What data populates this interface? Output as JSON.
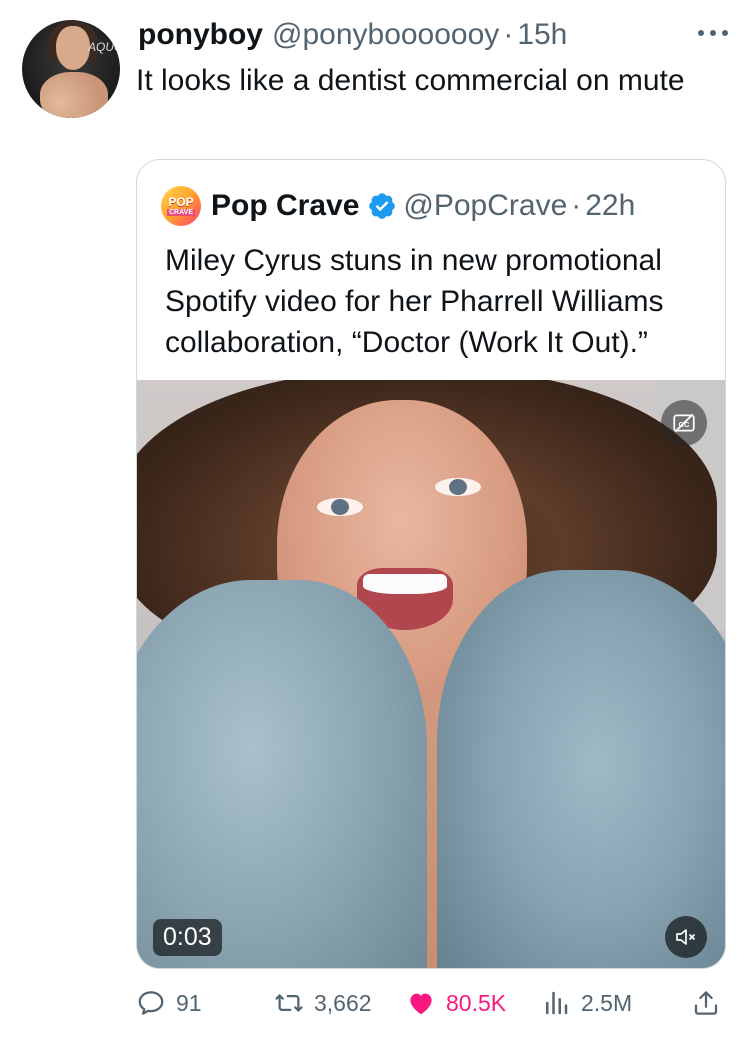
{
  "tweet": {
    "author_name": "ponyboy",
    "author_handle": "@ponybooooooy",
    "separator": "·",
    "time": "15h",
    "text": "It looks like a dentist commercial on mute",
    "avatar_logo_text": "AQUO"
  },
  "quoted_tweet": {
    "author_logo_top": "POP",
    "author_logo_bottom": "CRAVE",
    "author_name": "Pop Crave",
    "author_handle": "@PopCrave",
    "separator": "·",
    "time": "22h",
    "text": "Miley Cyrus stuns in new promotional Spotify video for her Pharrell Williams collaboration, “Doctor (Work It Out).”",
    "verified_color": "#1d9bf0",
    "video": {
      "timestamp": "0:03",
      "muted": true
    }
  },
  "actions": {
    "replies": "91",
    "retweets": "3,662",
    "likes": "80.5K",
    "views": "2.5M",
    "liked": true,
    "like_color": "#f91880"
  },
  "icons": {
    "more": "more-horizontal-icon",
    "captions": "captions-off-icon",
    "mute": "volume-muted-icon",
    "reply": "reply-icon",
    "retweet": "retweet-icon",
    "like": "heart-icon",
    "views": "views-icon",
    "share": "share-icon",
    "verified": "verified-badge-icon"
  }
}
